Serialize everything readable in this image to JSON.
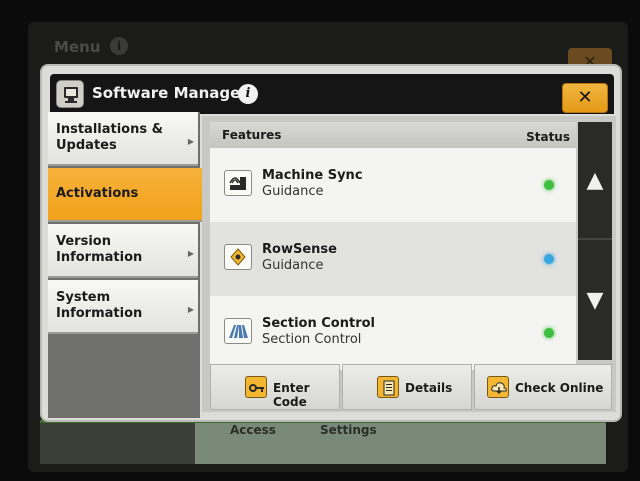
{
  "background": {
    "menu_label": "Menu",
    "bottom_labels": [
      "Access",
      "Settings"
    ]
  },
  "dialog": {
    "title": "Software Manager",
    "info_icon": "info-icon",
    "close_label": "✕"
  },
  "sidebar": {
    "items": [
      {
        "label": "Installations & Updates",
        "active": false
      },
      {
        "label": "Activations",
        "active": true
      },
      {
        "label": "Version Information",
        "active": false
      },
      {
        "label": "System Information",
        "active": false
      }
    ]
  },
  "features": {
    "header_features": "Features",
    "header_status": "Status",
    "rows": [
      {
        "name": "Machine Sync",
        "category": "Guidance",
        "icon": "machine-sync-icon",
        "status_color": "#3fbf3f"
      },
      {
        "name": "RowSense",
        "category": "Guidance",
        "icon": "rowsense-icon",
        "status_color": "#3aa6e0"
      },
      {
        "name": "Section Control",
        "category": "Section Control",
        "icon": "section-control-icon",
        "status_color": "#3fbf3f"
      }
    ]
  },
  "scroll": {
    "up_icon": "scroll-up-arrow-icon",
    "down_icon": "scroll-down-arrow-icon"
  },
  "buttons": {
    "enter_code": "Enter Code",
    "details": "Details",
    "check_online": "Check Online"
  },
  "colors": {
    "accent": "#f0a11b",
    "titlebar": "#151515"
  }
}
